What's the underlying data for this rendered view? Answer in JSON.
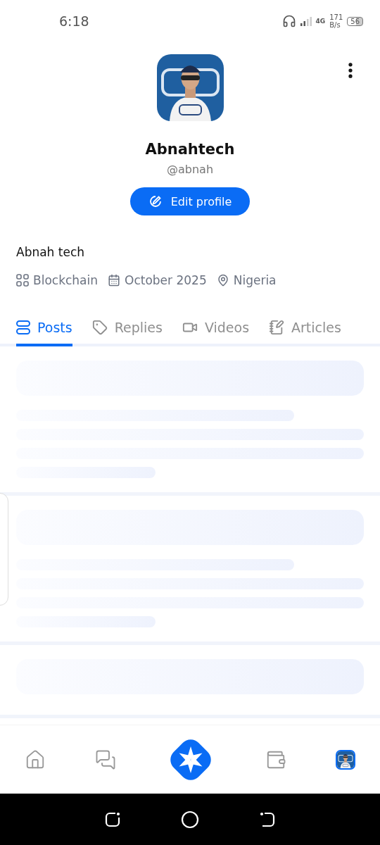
{
  "status_bar": {
    "time": "6:18",
    "network": "4G",
    "speed_value": "171",
    "speed_unit": "B/s",
    "battery": "56"
  },
  "profile": {
    "name": "Abnahtech",
    "handle": "@abnah",
    "edit_button": "Edit profile",
    "bio": "Abnah tech",
    "meta": [
      {
        "kind": "category",
        "text": "Blockchain"
      },
      {
        "kind": "date",
        "text": "October 2025"
      },
      {
        "kind": "location",
        "text": "Nigeria"
      }
    ]
  },
  "tabs": [
    {
      "kind": "posts",
      "label": "Posts",
      "selected": true
    },
    {
      "kind": "replies",
      "label": "Replies",
      "selected": false
    },
    {
      "kind": "videos",
      "label": "Videos",
      "selected": false
    },
    {
      "kind": "articles",
      "label": "Articles",
      "selected": false
    }
  ],
  "bottom_nav": [
    {
      "kind": "home",
      "selected": false
    },
    {
      "kind": "messages",
      "selected": false
    },
    {
      "kind": "create",
      "selected": false
    },
    {
      "kind": "wallet",
      "selected": false
    },
    {
      "kind": "profile",
      "selected": true
    }
  ]
}
